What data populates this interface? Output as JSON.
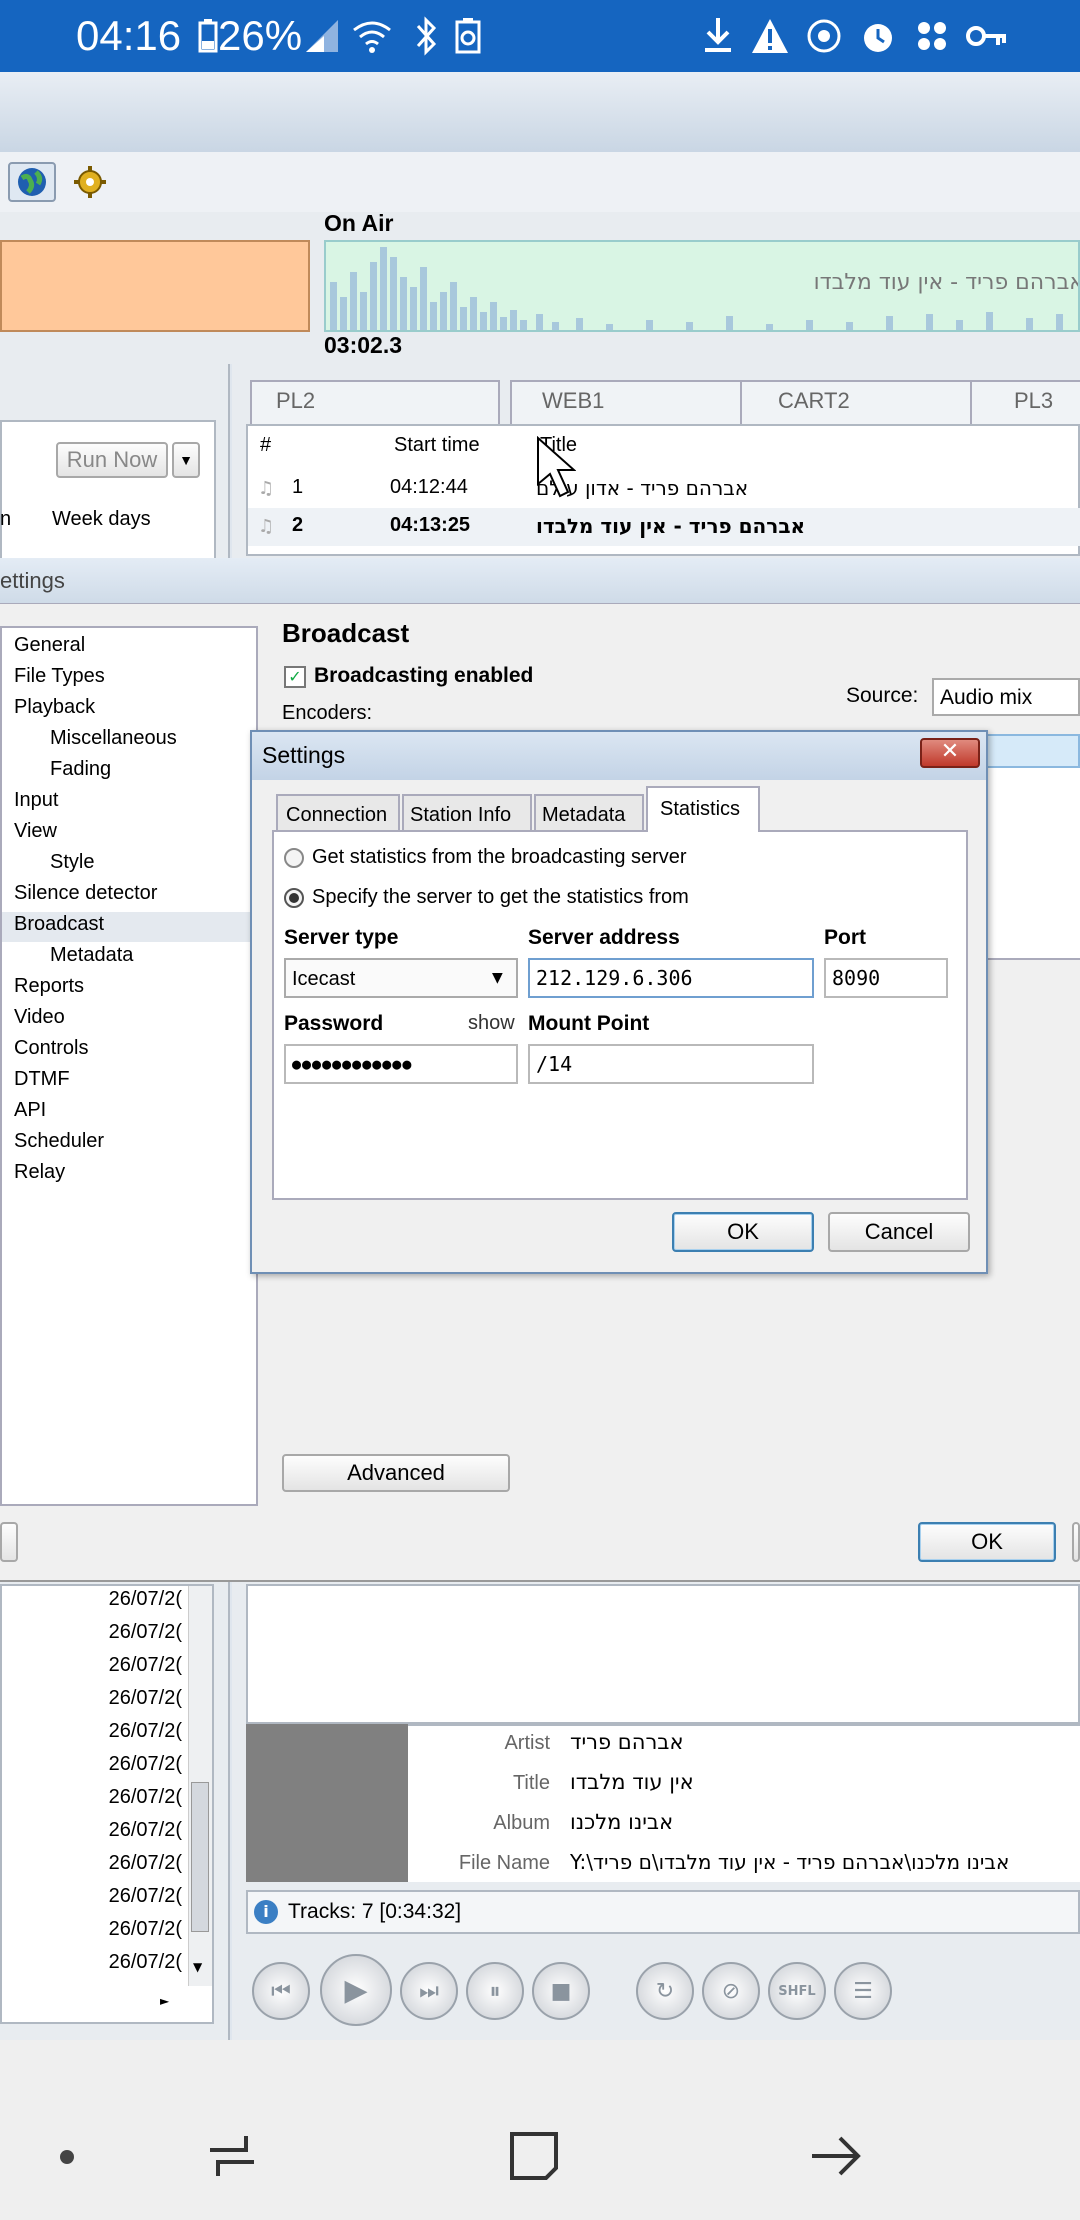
{
  "status_bar": {
    "time": "04:16",
    "battery": "26%"
  },
  "onair": {
    "label": "On Air",
    "now_playing": "אברהם פריד - אין עוד מלבדו",
    "time": "03:02.3"
  },
  "scheduler": {
    "run_now": "Run Now",
    "col_n": "n",
    "col_week_days": "Week days",
    "dates": [
      "26/07/2(",
      "26/07/2(",
      "26/07/2(",
      "26/07/2(",
      "26/07/2(",
      "26/07/2(",
      "26/07/2(",
      "26/07/2(",
      "26/07/2(",
      "26/07/2(",
      "26/07/2(",
      "26/07/2("
    ]
  },
  "playlist_tabs": [
    "PL2",
    "WEB1",
    "CART2",
    "PL3"
  ],
  "playlist": {
    "col_num": "#",
    "col_start": "Start time",
    "col_title": "Title",
    "rows": [
      {
        "num": "1",
        "start": "04:12:44",
        "title": "אברהם פריד - אדון עולם"
      },
      {
        "num": "2",
        "start": "04:13:25",
        "title": "אברהם פריד - אין עוד מלבדו"
      }
    ]
  },
  "settings_window": {
    "title": "ettings",
    "tree": [
      "General",
      "File Types",
      "Playback",
      "Miscellaneous",
      "Fading",
      "Input",
      "View",
      "Style",
      "Silence detector",
      "Broadcast",
      "Metadata",
      "Reports",
      "Video",
      "Controls",
      "DTMF",
      "API",
      "Scheduler",
      "Relay"
    ],
    "section_title": "Broadcast",
    "broadcasting_enabled": "Broadcasting enabled",
    "encoders": "Encoders:",
    "source_label": "Source:",
    "source_value": "Audio mix",
    "advanced": "Advanced",
    "ok": "OK"
  },
  "dialog": {
    "title": "Settings",
    "tabs": [
      "Connection",
      "Station Info",
      "Metadata",
      "Statistics"
    ],
    "radio1": "Get statistics from the broadcasting server",
    "radio2": "Specify the server to get the statistics from",
    "server_type_label": "Server type",
    "server_type_value": "Icecast",
    "server_address_label": "Server address",
    "server_address_value": "212.129.6.306",
    "port_label": "Port",
    "port_value": "8090",
    "password_label": "Password",
    "show": "show",
    "password_value": "●●●●●●●●●●●●",
    "mount_label": "Mount Point",
    "mount_value": "/14",
    "ok": "OK",
    "cancel": "Cancel"
  },
  "track_info": {
    "artist_label": "Artist",
    "artist": "אברהם פריד",
    "title_label": "Title",
    "title": "אין עוד מלבדו",
    "album_label": "Album",
    "album": "אבינו מלכנו",
    "filename_label": "File Name",
    "filename": "Y:\\אבינו מלכנו\\אברהם פריד - אין עוד מלבדו\\ם פריד",
    "tracks": "Tracks: 7 [0:34:32]"
  },
  "colors": {
    "status_bar": "#1565c0",
    "onair_orange": "#ffc89a",
    "waveform_bg": "#d9f5e4"
  }
}
